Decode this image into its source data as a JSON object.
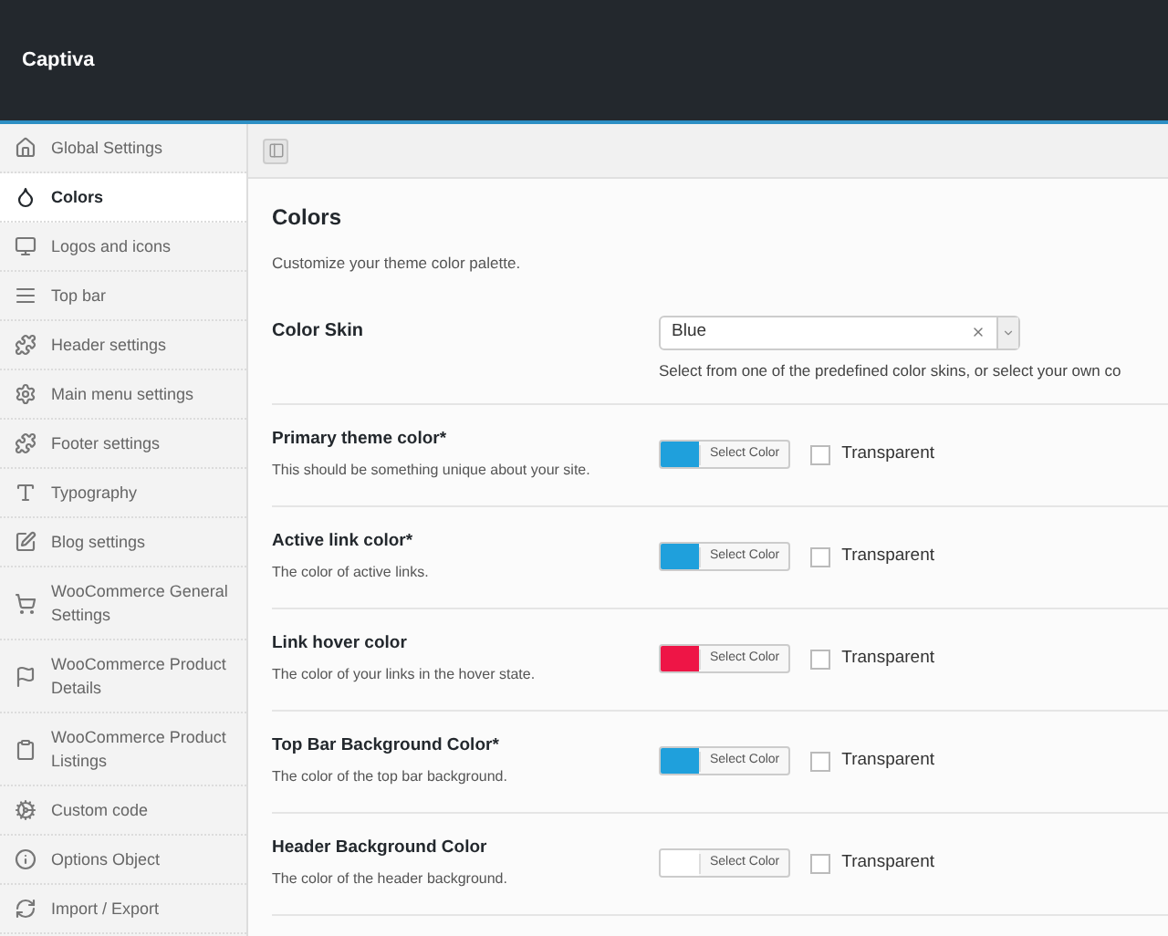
{
  "header": {
    "title": "Captiva"
  },
  "sidebar": {
    "items": [
      {
        "label": "Global Settings",
        "selected": false
      },
      {
        "label": "Colors",
        "selected": true
      },
      {
        "label": "Logos and icons",
        "selected": false
      },
      {
        "label": "Top bar",
        "selected": false
      },
      {
        "label": "Header settings",
        "selected": false
      },
      {
        "label": "Main menu settings",
        "selected": false
      },
      {
        "label": "Footer settings",
        "selected": false
      },
      {
        "label": "Typography",
        "selected": false
      },
      {
        "label": "Blog settings",
        "selected": false
      },
      {
        "label": "WooCommerce General Settings",
        "selected": false
      },
      {
        "label": "WooCommerce Product Details",
        "selected": false
      },
      {
        "label": "WooCommerce Product Listings",
        "selected": false
      },
      {
        "label": "Custom code",
        "selected": false
      },
      {
        "label": "Options Object",
        "selected": false
      },
      {
        "label": "Import / Export",
        "selected": false
      }
    ]
  },
  "section": {
    "title": "Colors",
    "description": "Customize your theme color palette."
  },
  "fields": [
    {
      "kind": "select",
      "label": "Color Skin",
      "value": "Blue",
      "help": "Select from one of the predefined color skins, or select your own co"
    },
    {
      "kind": "color",
      "label": "Primary theme color*",
      "description": "This should be something unique about your site.",
      "color": "#1fa0dc",
      "button": "Select Color",
      "transparent_label": "Transparent",
      "transparent": false
    },
    {
      "kind": "color",
      "label": "Active link color*",
      "description": "The color of active links.",
      "color": "#1fa0dc",
      "button": "Select Color",
      "transparent_label": "Transparent",
      "transparent": false
    },
    {
      "kind": "color",
      "label": "Link hover color",
      "description": "The color of your links in the hover state.",
      "color": "#ee1546",
      "button": "Select Color",
      "transparent_label": "Transparent",
      "transparent": false
    },
    {
      "kind": "color",
      "label": "Top Bar Background Color*",
      "description": "The color of the top bar background.",
      "color": "#1fa0dc",
      "button": "Select Color",
      "transparent_label": "Transparent",
      "transparent": false
    },
    {
      "kind": "color",
      "label": "Header Background Color",
      "description": "The color of the header background.",
      "color": "#ffffff",
      "button": "Select Color",
      "transparent_label": "Transparent",
      "transparent": false
    }
  ]
}
